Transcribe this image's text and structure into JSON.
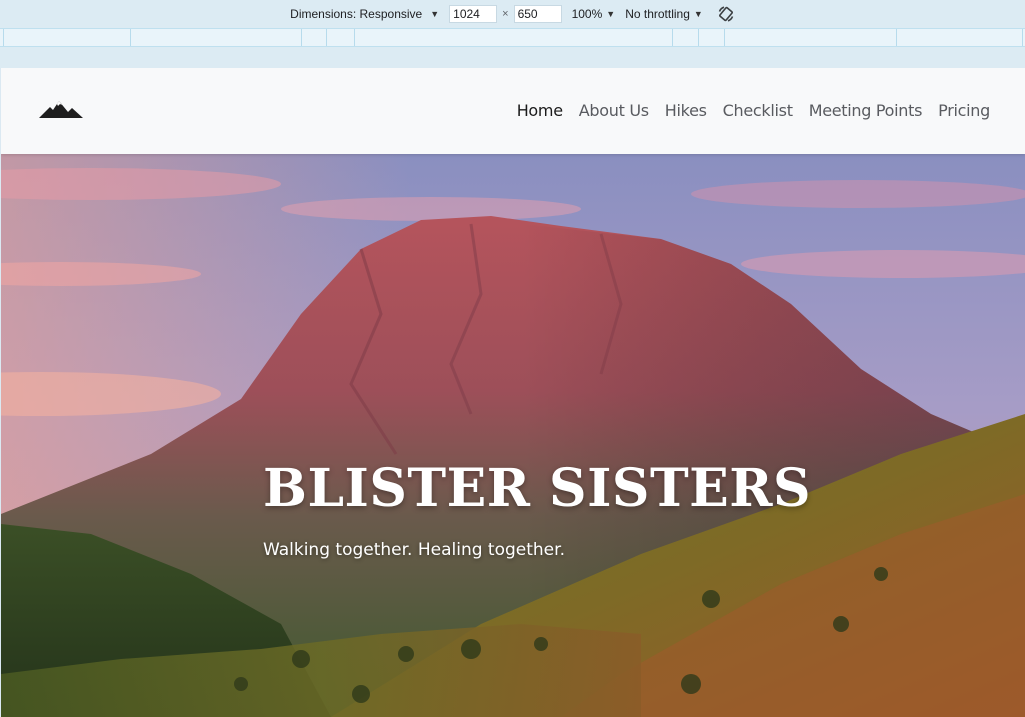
{
  "devtools": {
    "dimensions_label": "Dimensions: Responsive",
    "width": "1024",
    "height": "650",
    "times": "×",
    "zoom": "100%",
    "throttling": "No throttling",
    "caret": "▼"
  },
  "nav": {
    "items": [
      {
        "label": "Home",
        "active": true
      },
      {
        "label": "About Us"
      },
      {
        "label": "Hikes"
      },
      {
        "label": "Checklist"
      },
      {
        "label": "Meeting Points"
      },
      {
        "label": "Pricing"
      }
    ]
  },
  "hero": {
    "title": "BLISTER SISTERS",
    "subtitle": "Walking together. Healing together."
  },
  "colors": {
    "nav_bg": "#f8f9fa",
    "nav_active": "#1b1b1b",
    "nav_text": "#595b60",
    "devtools_bg": "#dcebf3"
  }
}
